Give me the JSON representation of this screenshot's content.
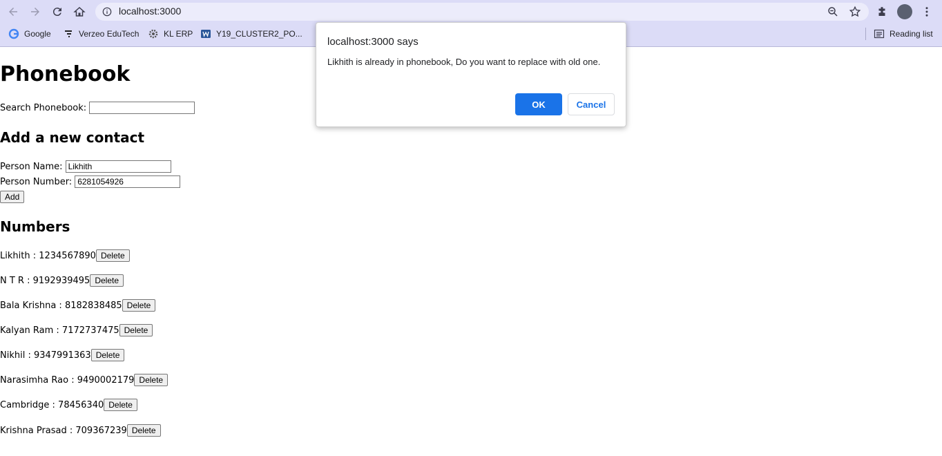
{
  "browser": {
    "url": "localhost:3000",
    "bookmarks": [
      "Google",
      "Verzeo EduTech",
      "KL ERP",
      "Y19_CLUSTER2_PO..."
    ],
    "reading_list": "Reading list",
    "theme_color": "#dcdcf7"
  },
  "page": {
    "title": "Phonebook",
    "search_label": "Search Phonebook:",
    "search_value": "",
    "add_heading": "Add a new contact",
    "name_label": "Person Name:",
    "name_value": "Likhith",
    "number_label": "Person Number:",
    "number_value": "6281054926",
    "add_button": "Add",
    "numbers_heading": "Numbers",
    "delete_label": "Delete",
    "contacts": [
      "Likhith : 1234567890",
      "N T R : 9192939495",
      "Bala Krishna : 8182838485",
      "Kalyan Ram : 7172737475",
      "Nikhil : 9347991363",
      "Narasimha Rao : 9490002179",
      "Cambridge : 78456340",
      "Krishna Prasad : 709367239"
    ]
  },
  "dialog": {
    "title": "localhost:3000 says",
    "message": "Likhith is already in phonebook, Do you want to replace with old one.",
    "ok": "OK",
    "cancel": "Cancel",
    "accent": "#1a73e8"
  },
  "icons": [
    "back-arrow-icon",
    "forward-arrow-icon",
    "reload-icon",
    "home-icon",
    "info-icon",
    "zoom-icon",
    "star-icon",
    "extensions-icon",
    "menu-icon",
    "reading-list-icon"
  ]
}
